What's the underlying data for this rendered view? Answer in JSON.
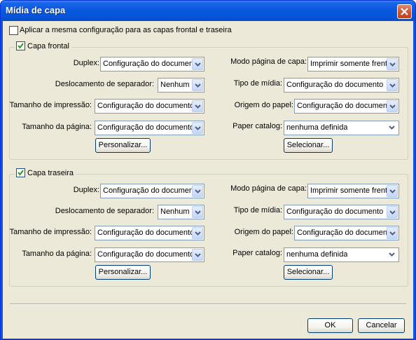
{
  "window": {
    "title": "Mídia de capa"
  },
  "apply_same": {
    "label": "Aplicar a mesma configuração para as capas frontal e traseira",
    "checked": false
  },
  "groups": [
    {
      "legend": "Capa frontal",
      "checked": true,
      "duplex_label": "Duplex:",
      "duplex_value": "Configuração do documento",
      "offset_label": "Deslocamento de separador:",
      "offset_value": "Nenhum",
      "print_size_label": "Tamanho de impressão:",
      "print_size_value": "Configuração do documento",
      "page_size_label": "Tamanho da página:",
      "page_size_value": "Configuração do documento",
      "customize_label": "Personalizar...",
      "page_mode_label": "Modo página de capa:",
      "page_mode_value": "Imprimir somente frente",
      "media_type_label": "Tipo de mídia:",
      "media_type_value": "Configuração do documento",
      "paper_source_label": "Origem do papel:",
      "paper_source_value": "Configuração do documento",
      "paper_catalog_label": "Paper catalog:",
      "paper_catalog_value": "nenhuma definida",
      "select_label": "Selecionar..."
    },
    {
      "legend": "Capa traseira",
      "checked": true,
      "duplex_label": "Duplex:",
      "duplex_value": "Configuração do documento",
      "offset_label": "Deslocamento de separador:",
      "offset_value": "Nenhum",
      "print_size_label": "Tamanho de impressão:",
      "print_size_value": "Configuração do documento",
      "page_size_label": "Tamanho da página:",
      "page_size_value": "Configuração do documento",
      "customize_label": "Personalizar...",
      "page_mode_label": "Modo página de capa:",
      "page_mode_value": "Imprimir somente frente",
      "media_type_label": "Tipo de mídia:",
      "media_type_value": "Configuração do documento",
      "paper_source_label": "Origem do papel:",
      "paper_source_value": "Configuração do documento",
      "paper_catalog_label": "Paper catalog:",
      "paper_catalog_value": "nenhuma definida",
      "select_label": "Selecionar..."
    }
  ],
  "footer": {
    "ok_label": "OK",
    "cancel_label": "Cancelar"
  }
}
